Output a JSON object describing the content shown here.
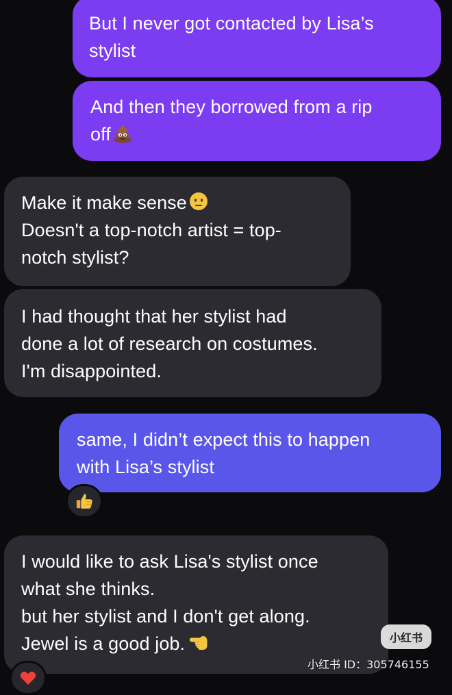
{
  "conversation": {
    "messages": [
      {
        "side": "sent",
        "lines": [
          "But I never got contacted by Lisa’s",
          "stylist"
        ]
      },
      {
        "side": "sent",
        "lines": [
          "And then they borrowed from a rip",
          "off"
        ]
      },
      {
        "side": "received",
        "lines": [
          "Make it make sense",
          "Doesn't a top-notch artist = top-",
          "notch stylist?"
        ]
      },
      {
        "side": "received",
        "lines": [
          "I had thought that her stylist had",
          "done a lot of research on costumes.",
          "I'm disappointed."
        ]
      },
      {
        "side": "sent",
        "lines": [
          "same, I didn’t expect this to happen",
          "with Lisa’s stylist"
        ]
      },
      {
        "side": "received",
        "lines": [
          "I would like to ask Lisa's stylist once",
          "what she thinks.",
          "but her stylist and I don't get along.",
          "Jewel is a good job."
        ]
      }
    ],
    "emojis": {
      "msg2": "pile-of-poo",
      "msg3": "neutral-face",
      "msg6": "backhand-pointing-left"
    },
    "reactions": [
      {
        "on": "message-5",
        "emoji": "thumbs-up"
      },
      {
        "on": "message-6",
        "emoji": "red-heart"
      }
    ]
  },
  "watermark": {
    "logo": "小红书",
    "id_text": "小红书 ID：305746155"
  },
  "colors": {
    "background": "#0b0b0e",
    "sent_purple": "#7b3cf2",
    "sent_blue": "#5b56ea",
    "received": "#2b2b31",
    "text": "#ffffff"
  }
}
